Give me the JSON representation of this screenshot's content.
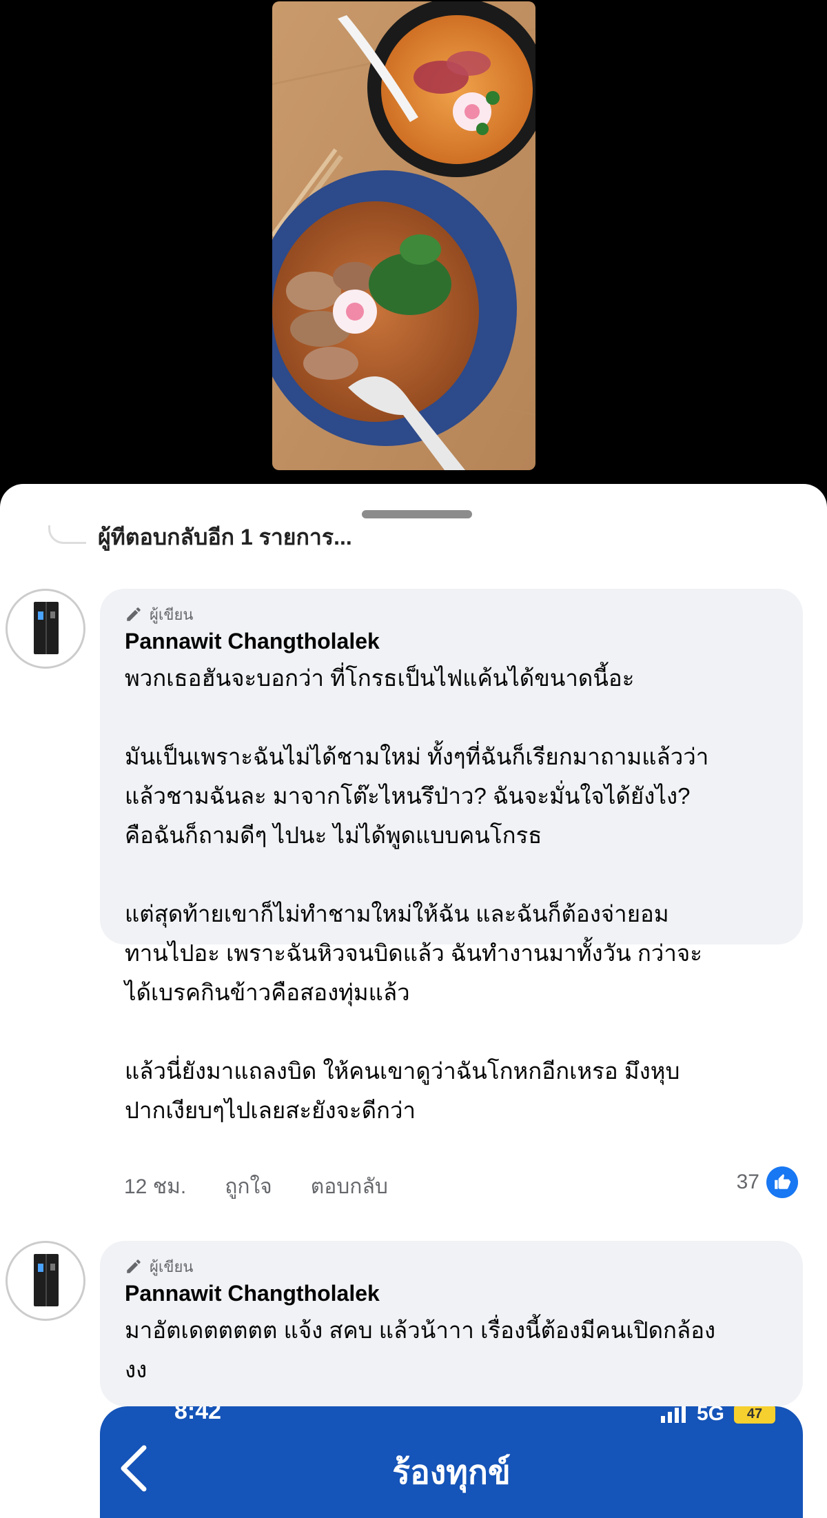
{
  "previous_reply": {
    "text": "ผู้ที่ตอบกลับอีก 1 รายการ..."
  },
  "comments": [
    {
      "author_badge": "ผู้เขียน",
      "author_name": "Pannawit Changtholalek",
      "text": "พวกเธอฮันจะบอกว่า ที่โกรธเป็นไฟแค้นได้ขนาดนี้อะ\n\nมันเป็นเพราะฉันไม่ได้ชามใหม่ ทั้งๆที่ฉันก็เรียกมาถามแล้วว่า\nแล้วชามฉันละ มาจากโต๊ะไหนรึป่าว? ฉันจะมั่นใจได้ยังไง?\nคือฉันก็ถามดีๆ ไปนะ ไม่ได้พูดแบบคนโกรธ\n\nแต่สุดท้ายเขาก็ไม่ทำชามใหม่ให้ฉัน และฉันก็ต้องจ่ายอม\nทานไปอะ เพราะฉันหิวจนบิดแล้ว ฉันทำงานมาทั้งวัน กว่าจะ\nได้เบรคกินข้าวคือสองทุ่มแล้ว\n\nแล้วนี่ยังมาแถลงบิด ให้คนเขาดูว่าฉันโกหกอีกเหรอ มึงหุบ\nปากเงียบๆไปเลยสะยังจะดีกว่า",
      "time": "12 ชม.",
      "like_label": "ถูกใจ",
      "reply_label": "ตอบกลับ",
      "reaction_count": "37"
    },
    {
      "author_badge": "ผู้เขียน",
      "author_name": "Pannawit Changtholalek",
      "text": "มาอัตเดตตตตต แจ้ง สคบ แล้วน้าาา เรื่องนี้ต้องมีคนเปิดกล้อง\nงง"
    }
  ],
  "embedded_screenshot": {
    "status_time": "8:42",
    "network": "5G",
    "battery": "47",
    "title": "ร้องทุกข์"
  },
  "colors": {
    "accent_blue": "#1877f2",
    "complaint_header": "#1554b8"
  }
}
